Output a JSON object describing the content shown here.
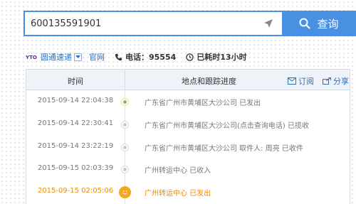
{
  "search": {
    "value": "600135591901",
    "button_label": "查询"
  },
  "info": {
    "logo_text": "YTO",
    "carrier": "圆通速递",
    "official_site": "官网",
    "phone": "电话：95554",
    "elapsed": "已耗时13小时"
  },
  "table": {
    "col_time": "时间",
    "col_place": "地点和跟踪进度",
    "subscribe": "订阅",
    "share": "分享",
    "rows": [
      {
        "time": "2015-09-14 22:04:38",
        "desc": "广东省广州市黄埔区大沙公司 已发出"
      },
      {
        "time": "2015-09-14 22:30:41",
        "desc": "广东省广州市黄埔区大沙公司(点击查询电话) 已揽收"
      },
      {
        "time": "2015-09-14 23:22:19",
        "desc": "广东省广州市黄埔区大沙公司 取件人: 周亮 已收件"
      },
      {
        "time": "2015-09-15 02:03:39",
        "desc": "广州转运中心 已收入"
      },
      {
        "time": "2015-09-15 02:05:06",
        "desc": "广州转运中心 已发出"
      }
    ]
  },
  "colors": {
    "accent": "#4a90e2",
    "highlight": "#f08a00",
    "first_dot": "#7bc043"
  }
}
